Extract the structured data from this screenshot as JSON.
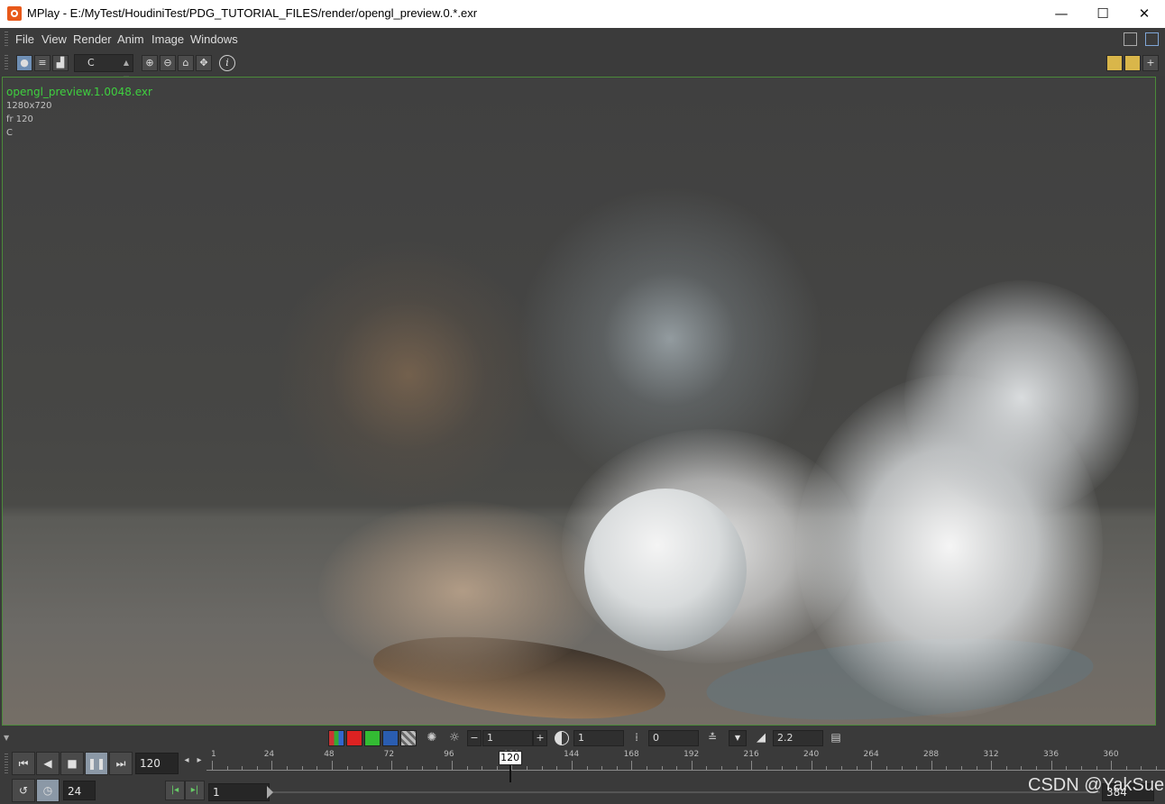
{
  "window": {
    "title": "MPlay - E:/MyTest/HoudiniTest/PDG_TUTORIAL_FILES/render/opengl_preview.0.*.exr",
    "minimize": "—",
    "maximize": "☐",
    "close": "✕"
  },
  "menu": [
    "File",
    "View",
    "Render",
    "Anim",
    "Image",
    "Windows"
  ],
  "toolbar": {
    "channel": "C",
    "info_icon": "i"
  },
  "image_info": {
    "filename": "opengl_preview.1.0048.exr",
    "resolution": "1280x720",
    "frame": "fr 120",
    "channel": "C"
  },
  "color_controls": {
    "exposure": "1",
    "gamma_field": "1",
    "black": "0",
    "gamma": "2.2"
  },
  "playback": {
    "current_frame": "120",
    "fps": "24",
    "start_frame": "1",
    "end_frame": "384",
    "frame_marker": "120"
  },
  "timeline": {
    "labels": [
      "1",
      "24",
      "48",
      "72",
      "96",
      "120",
      "144",
      "168",
      "192",
      "216",
      "240",
      "264",
      "288",
      "312",
      "336",
      "360"
    ]
  },
  "watermark": "CSDN @YakSue",
  "colors": {
    "viewport_border": "#4b8a3a",
    "filename_green": "#3fcf3f",
    "accent_blue": "#6f8fb5"
  }
}
